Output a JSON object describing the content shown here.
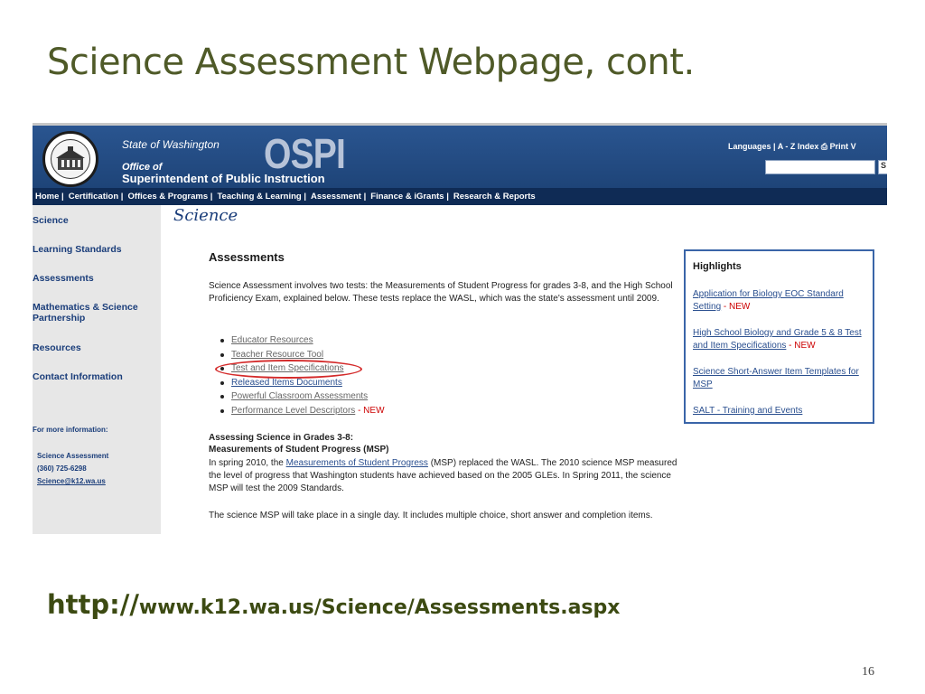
{
  "slide": {
    "title": "Science Assessment Webpage, cont.",
    "url_prefix": "http://",
    "url_rest": "www.k12.wa.us/Science/Assessments.aspx",
    "page_number": "16"
  },
  "header": {
    "state": "State of Washington",
    "office": "Office of",
    "superintendent": "Superintendent of Public Instruction",
    "logo_text": "OSPI",
    "utility_links": "Languages   |  A - Z Index    ⎙ Print V",
    "search_button": "S"
  },
  "nav": {
    "items": [
      "Home |",
      "Certification |",
      "Offices & Programs |",
      "Teaching & Learning |",
      "Assessment |",
      "Finance & iGrants |",
      "Research & Reports"
    ]
  },
  "sidebar": {
    "items": [
      "Science",
      "Learning Standards",
      "Assessments",
      "Mathematics & Science Partnership",
      "Resources",
      "Contact Information"
    ],
    "more_info": "For more information:",
    "contact_name": "Science Assessment",
    "contact_phone": "(360) 725-6298",
    "contact_email": "Science@k12.wa.us"
  },
  "main": {
    "section_logo": "Science",
    "heading": "Assessments",
    "intro": "Science Assessment involves two tests: the Measurements of Student Progress for grades 3-8, and the High School Proficiency Exam, explained below. These tests replace the WASL, which was the state's assessment until 2009.",
    "links": [
      "Educator Resources",
      "Teacher Resource Tool",
      "Test and Item Specifications",
      "Released Items Documents",
      "Powerful Classroom Assessments",
      "Performance Level Descriptors"
    ],
    "new_tag": "- NEW",
    "msp_heading_1": "Assessing Science in Grades 3-8:",
    "msp_heading_2": "Measurements of Student Progress (MSP)",
    "msp_text_a": "In spring 2010, the ",
    "msp_link": "Measurements of Student Progress",
    "msp_text_b": " (MSP) replaced the WASL. The 2010 science MSP measured the level of progress that Washington students have achieved based on the 2005 GLEs. In Spring 2011, the science MSP will test the 2009 Standards.",
    "msp_day": "The science MSP will take place in a single day. It includes multiple choice, short answer and completion items."
  },
  "highlights": {
    "title": "Highlights",
    "items": [
      {
        "text": "Application for Biology EOC Standard Setting",
        "new": true
      },
      {
        "text": "High School Biology and Grade 5 & 8 Test and Item Specifications",
        "new": true
      },
      {
        "text": "Science Short-Answer Item Templates for MSP",
        "new": false
      },
      {
        "text": "SALT - Training and Events",
        "new": false
      }
    ]
  },
  "colors": {
    "title": "#4f5a28",
    "header_blue": "#2a5590",
    "nav_dark": "#0f2b55",
    "link_blue": "#1a3d7a",
    "highlight_red": "#d42a2a"
  }
}
